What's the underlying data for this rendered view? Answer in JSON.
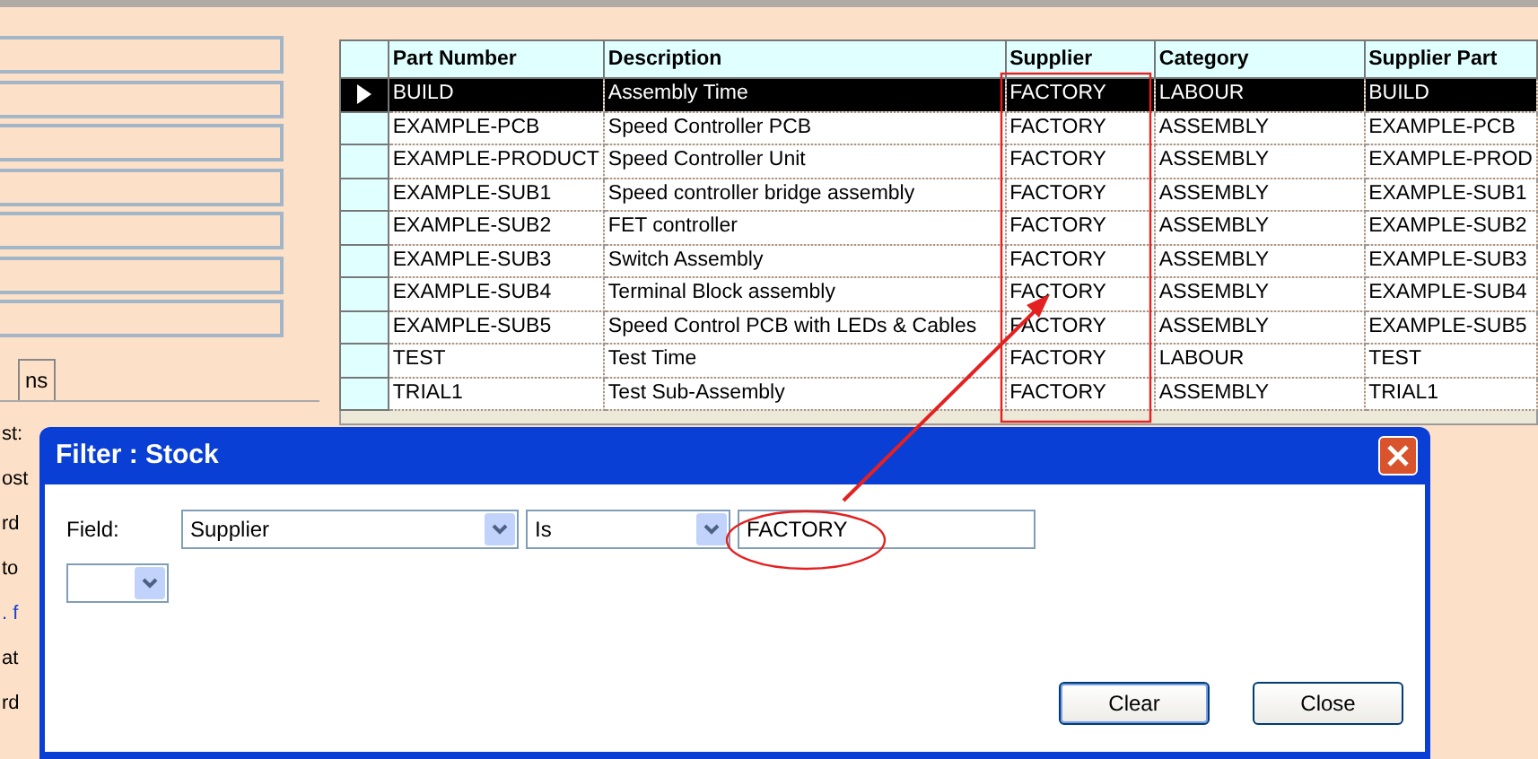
{
  "side_tab": {
    "label": "ns"
  },
  "side_labels": [
    {
      "text": "st:",
      "kind": "plain"
    },
    {
      "text": "ost",
      "kind": "plain"
    },
    {
      "text": "rd",
      "kind": "plain"
    },
    {
      "text": "to",
      "kind": "plain"
    },
    {
      "text": ". f",
      "kind": "link"
    },
    {
      "text": "at",
      "kind": "plain"
    },
    {
      "text": "rd",
      "kind": "plain"
    }
  ],
  "table": {
    "columns": [
      "Part Number",
      "Description",
      "Supplier",
      "Category",
      "Supplier Part"
    ],
    "rows": [
      {
        "selected": true,
        "cells": [
          "BUILD",
          "Assembly Time",
          "FACTORY",
          "LABOUR",
          "BUILD"
        ]
      },
      {
        "selected": false,
        "cells": [
          "EXAMPLE-PCB",
          "Speed Controller PCB",
          "FACTORY",
          "ASSEMBLY",
          "EXAMPLE-PCB"
        ]
      },
      {
        "selected": false,
        "cells": [
          "EXAMPLE-PRODUCT",
          "Speed Controller Unit",
          "FACTORY",
          "ASSEMBLY",
          "EXAMPLE-PROD"
        ]
      },
      {
        "selected": false,
        "cells": [
          "EXAMPLE-SUB1",
          "Speed controller bridge assembly",
          "FACTORY",
          "ASSEMBLY",
          "EXAMPLE-SUB1"
        ]
      },
      {
        "selected": false,
        "cells": [
          "EXAMPLE-SUB2",
          "FET controller",
          "FACTORY",
          "ASSEMBLY",
          "EXAMPLE-SUB2"
        ]
      },
      {
        "selected": false,
        "cells": [
          "EXAMPLE-SUB3",
          "Switch Assembly",
          "FACTORY",
          "ASSEMBLY",
          "EXAMPLE-SUB3"
        ]
      },
      {
        "selected": false,
        "cells": [
          "EXAMPLE-SUB4",
          "Terminal Block assembly",
          "FACTORY",
          "ASSEMBLY",
          "EXAMPLE-SUB4"
        ]
      },
      {
        "selected": false,
        "cells": [
          "EXAMPLE-SUB5",
          "Speed Control PCB with LEDs & Cables",
          "FACTORY",
          "ASSEMBLY",
          "EXAMPLE-SUB5"
        ]
      },
      {
        "selected": false,
        "cells": [
          "TEST",
          "Test Time",
          "FACTORY",
          "LABOUR",
          "TEST"
        ]
      },
      {
        "selected": false,
        "cells": [
          "TRIAL1",
          "Test Sub-Assembly",
          "FACTORY",
          "ASSEMBLY",
          "TRIAL1"
        ]
      }
    ]
  },
  "dialog": {
    "title": "Filter : Stock",
    "field_label": "Field:",
    "field_select": "Supplier",
    "operator_select": "Is",
    "value": "FACTORY",
    "buttons": [
      "Clear",
      "Close"
    ]
  }
}
